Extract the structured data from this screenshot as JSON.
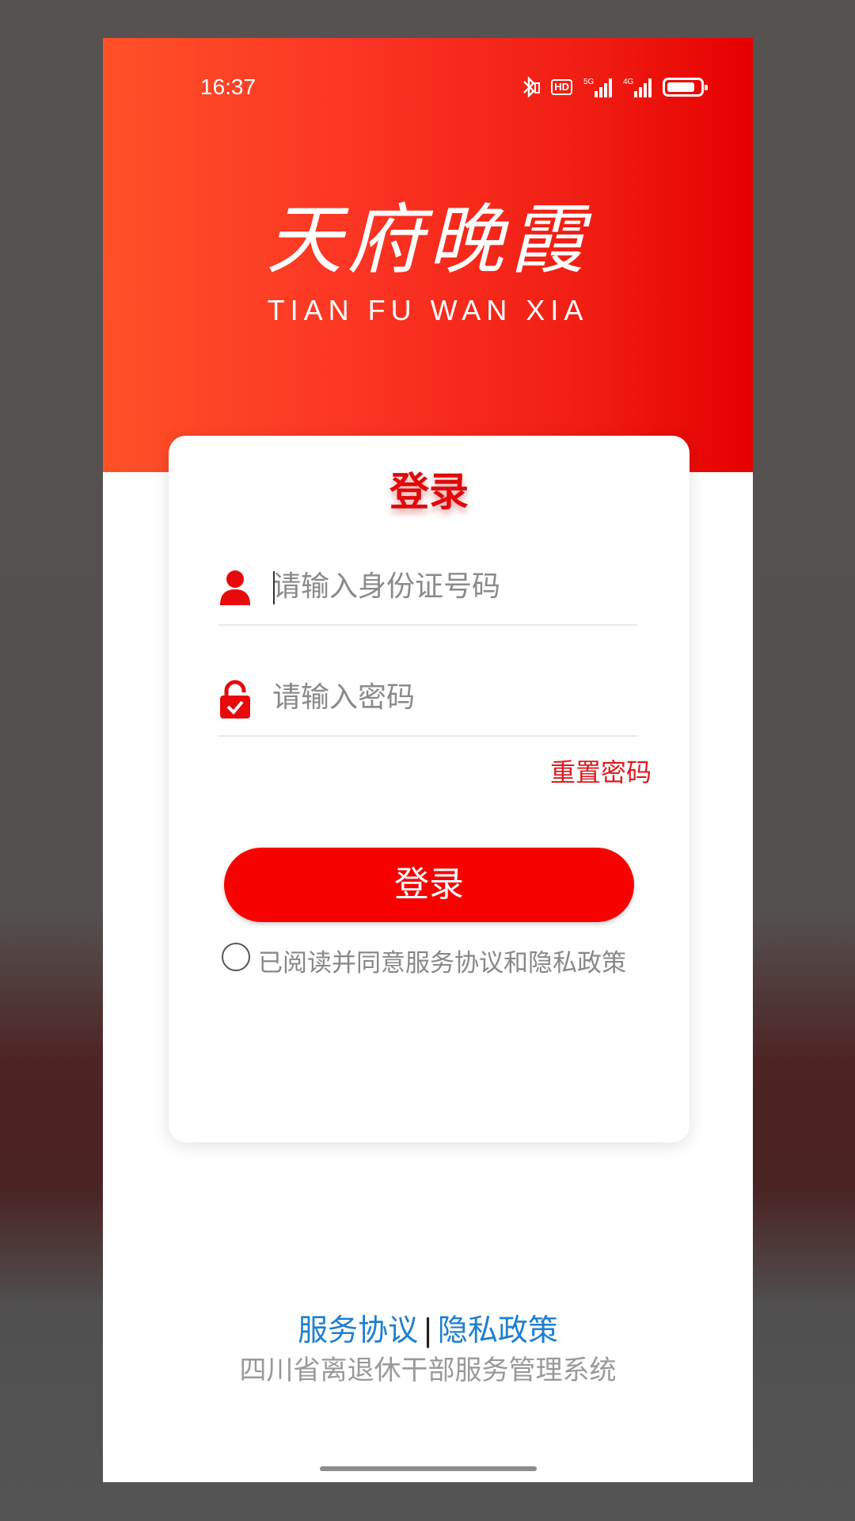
{
  "status_bar": {
    "time": "16:37",
    "hd_label": "HD",
    "net_5g": "5G",
    "net_4g": "4G",
    "icons": [
      "bluetooth-icon",
      "hd-icon",
      "signal-5g-icon",
      "signal-4g-icon",
      "battery-icon"
    ]
  },
  "brand": {
    "name_cn": "天府晚霞",
    "name_en": "TIAN FU WAN XIA",
    "primary_color": "#f80200",
    "header_gradient": [
      "#ff5128",
      "#e60000"
    ]
  },
  "login_card": {
    "title": "登录",
    "id_field": {
      "placeholder": "请输入身份证号码",
      "value": "",
      "icon": "user-icon"
    },
    "password_field": {
      "placeholder": "请输入密码",
      "value": "",
      "icon": "lock-icon"
    },
    "reset_password": "重置密码",
    "login_button": "登录",
    "agreement_text": "已阅读并同意服务协议和隐私政策",
    "agreement_checked": false
  },
  "footer": {
    "service_agreement": "服务协议",
    "separator": "|",
    "privacy_policy": "隐私政策",
    "organization": "四川省离退休干部服务管理系统",
    "link_color": "#1c7fd2"
  }
}
